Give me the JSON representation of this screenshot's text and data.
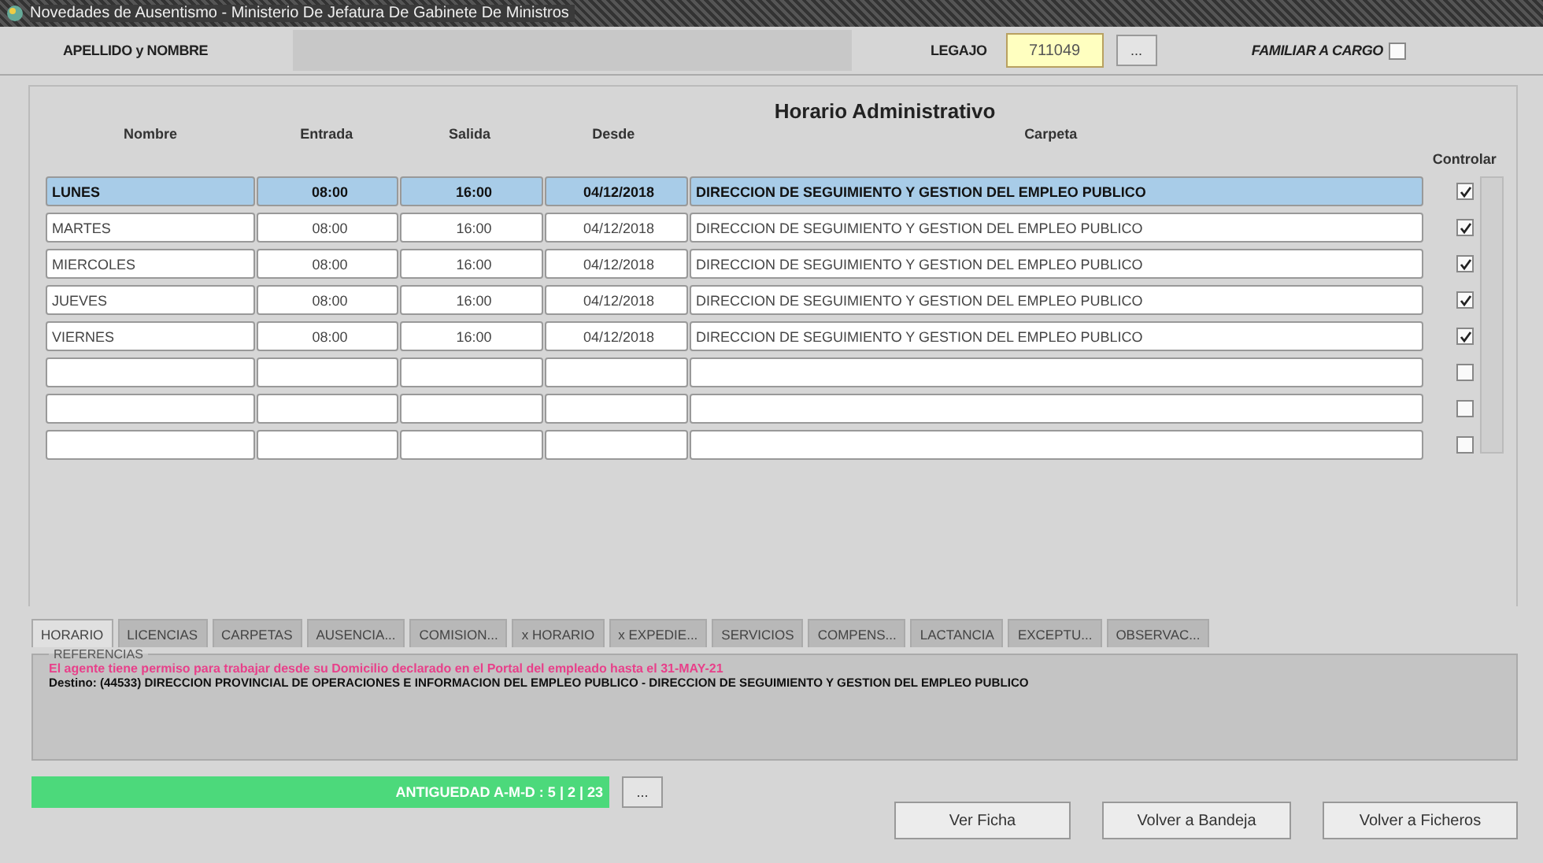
{
  "window": {
    "title": "Novedades de Ausentismo - Ministerio De Jefatura De Gabinete De Ministros"
  },
  "header": {
    "name_label": "APELLIDO y NOMBRE",
    "legajo_label": "LEGAJO",
    "legajo_value": "711049",
    "lookup_button": "...",
    "familiar_label": "FAMILIAR A CARGO",
    "familiar_checked": false
  },
  "schedule": {
    "title": "Horario Administrativo",
    "columns": [
      "Nombre",
      "Entrada",
      "Salida",
      "Desde",
      "Carpeta"
    ],
    "control_column": "Controlar",
    "rows": [
      {
        "cells": [
          "LUNES",
          "08:00",
          "16:00",
          "04/12/2018",
          "DIRECCION DE SEGUIMIENTO Y GESTION DEL EMPLEO PUBLICO"
        ],
        "checked": true,
        "selected": true
      },
      {
        "cells": [
          "MARTES",
          "08:00",
          "16:00",
          "04/12/2018",
          "DIRECCION DE SEGUIMIENTO Y GESTION DEL EMPLEO PUBLICO"
        ],
        "checked": true,
        "selected": false
      },
      {
        "cells": [
          "MIERCOLES",
          "08:00",
          "16:00",
          "04/12/2018",
          "DIRECCION DE SEGUIMIENTO Y GESTION DEL EMPLEO PUBLICO"
        ],
        "checked": true,
        "selected": false
      },
      {
        "cells": [
          "JUEVES",
          "08:00",
          "16:00",
          "04/12/2018",
          "DIRECCION DE SEGUIMIENTO Y GESTION DEL EMPLEO PUBLICO"
        ],
        "checked": true,
        "selected": false
      },
      {
        "cells": [
          "VIERNES",
          "08:00",
          "16:00",
          "04/12/2018",
          "DIRECCION DE SEGUIMIENTO Y GESTION DEL EMPLEO PUBLICO"
        ],
        "checked": true,
        "selected": false
      },
      {
        "checked": false,
        "selected": false
      },
      {
        "checked": false,
        "selected": false
      },
      {
        "checked": false,
        "selected": false
      }
    ]
  },
  "tabs": [
    {
      "label": "HORARIO",
      "selected": true
    },
    {
      "label": "LICENCIAS",
      "selected": false
    },
    {
      "label": "CARPETAS",
      "selected": false
    },
    {
      "label": "AUSENCIA...",
      "selected": false
    },
    {
      "label": "COMISION...",
      "selected": false
    },
    {
      "label": "x HORARIO",
      "selected": false
    },
    {
      "label": "x EXPEDIE...",
      "selected": false
    },
    {
      "label": "SERVICIOS",
      "selected": false
    },
    {
      "label": "COMPENS...",
      "selected": false
    },
    {
      "label": "LACTANCIA",
      "selected": false
    },
    {
      "label": "EXCEPTU...",
      "selected": false
    },
    {
      "label": "OBSERVAC...",
      "selected": false
    }
  ],
  "references": {
    "legend": "REFERENCIAS",
    "notice": "El agente tiene permiso para trabajar desde su Domicilio declarado en el Portal del empleado hasta el 31-MAY-21",
    "destination": "Destino: (44533) DIRECCION PROVINCIAL DE OPERACIONES E INFORMACION DEL EMPLEO PUBLICO - DIRECCION DE SEGUIMIENTO Y GESTION DEL EMPLEO PUBLICO"
  },
  "footer": {
    "seniority": "ANTIGUEDAD A-M-D :  5 | 2 | 23",
    "seniority_button": "...",
    "buttons": [
      "Ver Ficha",
      "Volver a Bandeja",
      "Volver a Ficheros"
    ]
  }
}
